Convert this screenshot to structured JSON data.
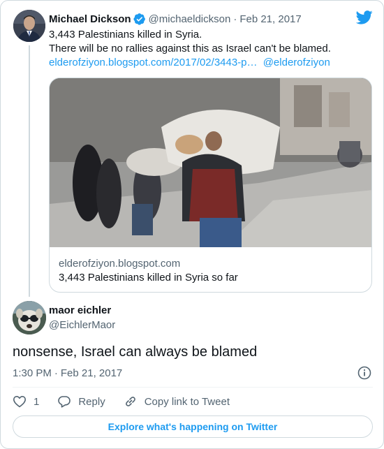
{
  "colors": {
    "accent": "#1d9bf0",
    "text": "#0f1419",
    "secondary": "#536471",
    "border": "#cfd9de"
  },
  "icons": {
    "logo": "twitter-bird-icon",
    "verified": "verified-badge-icon",
    "info": "info-icon",
    "like": "heart-icon",
    "reply": "reply-bubble-icon",
    "copy": "link-icon"
  },
  "parent_tweet": {
    "author_name": "Michael Dickson",
    "handle": "@michaeldickson",
    "separator": "·",
    "date": "Feb 21, 2017",
    "line1": "3,443 Palestinians killed in Syria.",
    "line2": "There will be no rallies against this as Israel can't be blamed.",
    "link_text": "elderofziyon.blogspot.com/2017/02/3443-p…",
    "mention": "@elderofziyon",
    "card": {
      "domain": "elderofziyon.blogspot.com",
      "title": "3,443 Palestinians killed in Syria so far"
    }
  },
  "reply_tweet": {
    "author_name": "maor eichler",
    "handle": "@EichlerMaor",
    "text": "nonsense, Israel can always be blamed",
    "time": "1:30 PM",
    "separator": "·",
    "date": "Feb 21, 2017"
  },
  "actions": {
    "like_count": "1",
    "reply_label": "Reply",
    "copy_label": "Copy link to Tweet"
  },
  "explore_label": "Explore what's happening on Twitter"
}
